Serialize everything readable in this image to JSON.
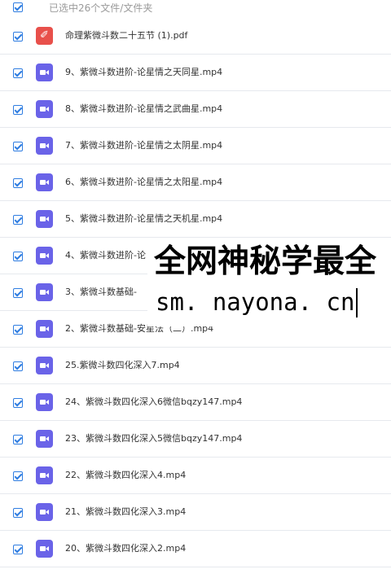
{
  "header": {
    "selection_text": "已选中26个文件/文件夹"
  },
  "files": [
    {
      "name": "命理紫微斗数二十五节 (1).pdf",
      "type": "pdf",
      "checked": true
    },
    {
      "name": "9、紫微斗数进阶-论星情之天同星.mp4",
      "type": "video",
      "checked": true
    },
    {
      "name": "8、紫微斗数进阶-论星情之武曲星.mp4",
      "type": "video",
      "checked": true
    },
    {
      "name": "7、紫微斗数进阶-论星情之太阴星.mp4",
      "type": "video",
      "checked": true
    },
    {
      "name": "6、紫微斗数进阶-论星情之太阳星.mp4",
      "type": "video",
      "checked": true
    },
    {
      "name": "5、紫微斗数进阶-论星情之天机星.mp4",
      "type": "video",
      "checked": true
    },
    {
      "name": "4、紫微斗数进阶-论",
      "type": "video",
      "checked": true
    },
    {
      "name": "3、紫微斗数基础-",
      "type": "video",
      "checked": true
    },
    {
      "name": "2、紫微斗数基础-安星法（二）.mp4",
      "type": "video",
      "checked": true
    },
    {
      "name": "25.紫微斗数四化深入7.mp4",
      "type": "video",
      "checked": true
    },
    {
      "name": "24、紫微斗数四化深入6微信bqzy147.mp4",
      "type": "video",
      "checked": true
    },
    {
      "name": "23、紫微斗数四化深入5微信bqzy147.mp4",
      "type": "video",
      "checked": true
    },
    {
      "name": "22、紫微斗数四化深入4.mp4",
      "type": "video",
      "checked": true
    },
    {
      "name": "21、紫微斗数四化深入3.mp4",
      "type": "video",
      "checked": true
    },
    {
      "name": "20、紫微斗数四化深入2.mp4",
      "type": "video",
      "checked": true
    }
  ],
  "watermark": {
    "line1": "全网神秘学最全",
    "line2": "sm. nayona. cn"
  },
  "colors": {
    "checkbox": "#2f7de1",
    "video_icon": "#6a63e8",
    "pdf_icon": "#e8504b",
    "divider": "#e6e9ee"
  },
  "icons": {
    "checkbox": "checkmark-icon",
    "video": "video-file-icon",
    "pdf": "pdf-file-icon"
  }
}
